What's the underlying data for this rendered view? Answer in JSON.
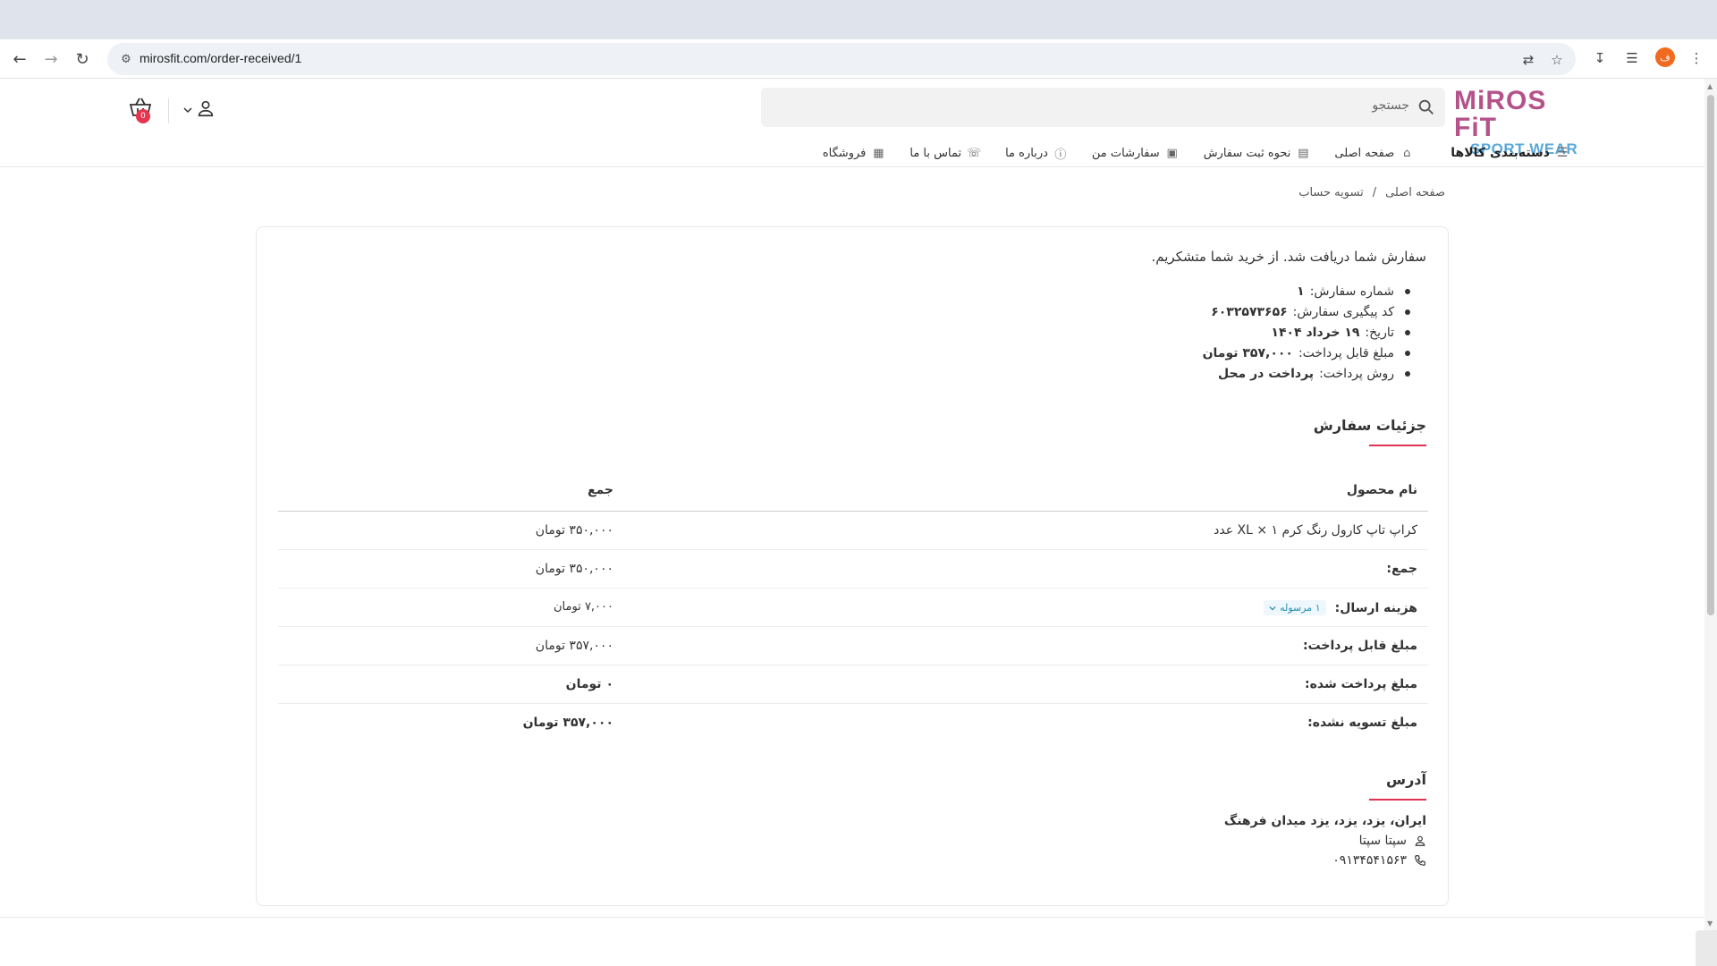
{
  "browser": {
    "url": "mirosfit.com/order-received/1",
    "profile_initial": "ف"
  },
  "site": {
    "logo_top": "MiROS FiT",
    "logo_bottom": "SPORT WEAR",
    "search_placeholder": "جستجو",
    "cart_count": "0",
    "menu": {
      "categories": "دسته‌بندی کالاها",
      "home": "صفحه اصلی",
      "how_to_order": "نحوه ثبت سفارش",
      "my_orders": "سفارشات من",
      "about": "درباره ما",
      "contact": "تماس با ما",
      "shop": "فروشگاه"
    },
    "breadcrumb": {
      "home": "صفحه اصلی",
      "sep": "/",
      "current": "تسویه حساب"
    }
  },
  "order": {
    "thanks": "سفارش شما دریافت شد. از خرید شما متشکریم.",
    "info": [
      {
        "label": "شماره سفارش:",
        "value": "۱"
      },
      {
        "label": "کد پیگیری سفارش:",
        "value": "۶۰۳۲۵۷۳۶۵۶"
      },
      {
        "label": "تاریخ:",
        "value": "۱۹ خرداد ۱۴۰۴"
      },
      {
        "label": "مبلغ قابل پرداخت:",
        "value": "۳۵۷,۰۰۰ تومان"
      },
      {
        "label": "روش پرداخت:",
        "value": "پرداخت در محل"
      }
    ],
    "details_title": "جزئیات سفارش",
    "table": {
      "col_product": "نام محصول",
      "col_total": "جمع",
      "rows": [
        {
          "label": "کراپ تاپ کارول رنگ کرم XL × ۱ عدد",
          "value": "۳۵۰,۰۰۰ تومان"
        },
        {
          "label": "جمع:",
          "value": "۳۵۰,۰۰۰ تومان"
        },
        {
          "label": "هزینه ارسال:",
          "badge": "۱ مرسوله",
          "value": "۷,۰۰۰ تومان"
        },
        {
          "label": "مبلغ قابل پرداخت:",
          "value": "۳۵۷,۰۰۰ تومان"
        },
        {
          "label": "مبلغ پرداخت شده:",
          "value": "۰ تومان"
        },
        {
          "label": "مبلغ تسویه نشده:",
          "value": "۳۵۷,۰۰۰ تومان"
        }
      ]
    },
    "address_title": "آدرس",
    "address": "ایران، یزد، یزد، یزد میدان فرهنگ",
    "recipient": "سپتا سپتا",
    "phone": "۰۹۱۳۴۵۴۱۵۶۳"
  },
  "colors": {
    "accent": "#e0334f",
    "paid_green": "#2e9d3e",
    "logo_pink": "#b5528a",
    "logo_blue": "#5aa8d8"
  }
}
